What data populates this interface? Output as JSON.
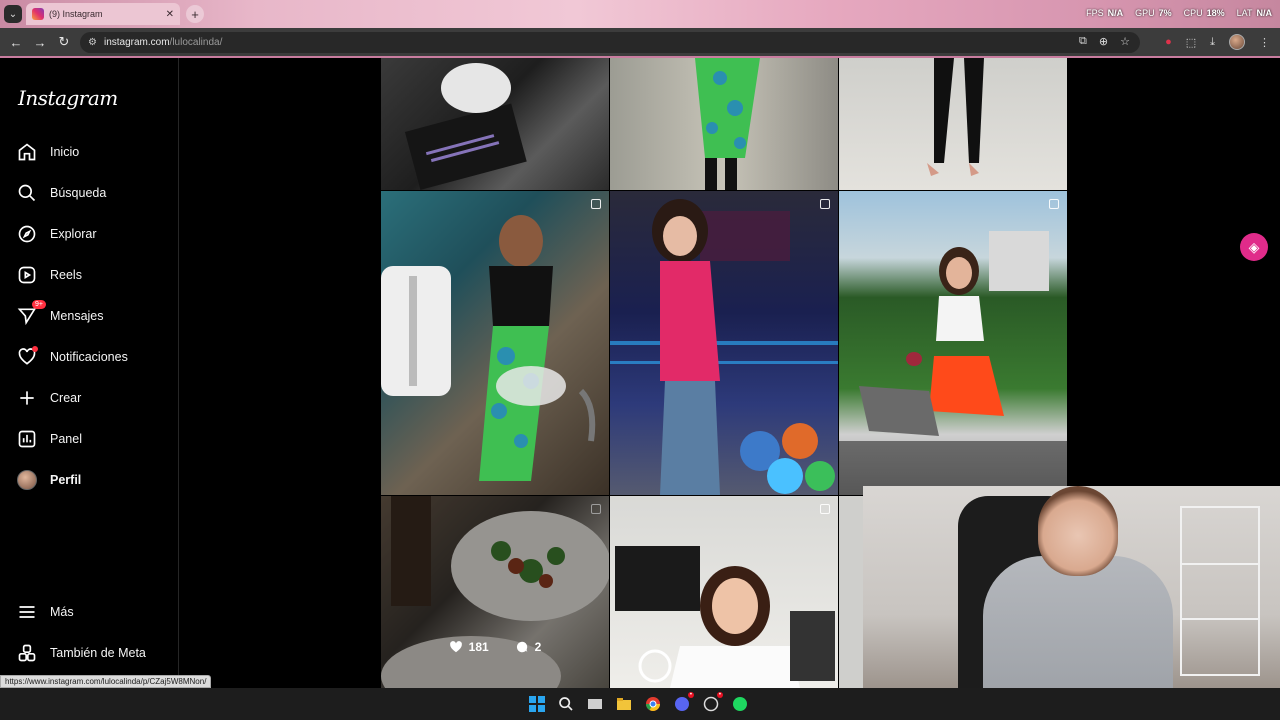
{
  "browser": {
    "tab_title": "(9) Instagram",
    "url_host": "instagram.com",
    "url_path": "/lulocalinda/",
    "stats": [
      {
        "label": "FPS",
        "value": "N/A"
      },
      {
        "label": "GPU",
        "value": "7%"
      },
      {
        "label": "CPU",
        "value": "18%"
      },
      {
        "label": "LAT",
        "value": "N/A"
      }
    ],
    "hover_link": "https://www.instagram.com/lulocalinda/p/CZaj5W8MNon/"
  },
  "sidebar": {
    "logo": "Instagram",
    "items": [
      {
        "label": "Inicio",
        "icon": "home-icon"
      },
      {
        "label": "Búsqueda",
        "icon": "search-icon"
      },
      {
        "label": "Explorar",
        "icon": "compass-icon"
      },
      {
        "label": "Reels",
        "icon": "reels-icon"
      },
      {
        "label": "Mensajes",
        "icon": "messenger-icon",
        "badge": "9+"
      },
      {
        "label": "Notificaciones",
        "icon": "heart-icon"
      },
      {
        "label": "Crear",
        "icon": "plus-icon"
      },
      {
        "label": "Panel",
        "icon": "dashboard-icon"
      },
      {
        "label": "Perfil",
        "icon": "profile-avatar"
      }
    ],
    "bottom": [
      {
        "label": "Más",
        "icon": "menu-icon"
      },
      {
        "label": "También de Meta",
        "icon": "meta-apps-icon"
      }
    ]
  },
  "hovered_post": {
    "likes": "181",
    "comments": "2"
  },
  "colors": {
    "accent": "#e02b8a",
    "notification": "#ff3040"
  }
}
